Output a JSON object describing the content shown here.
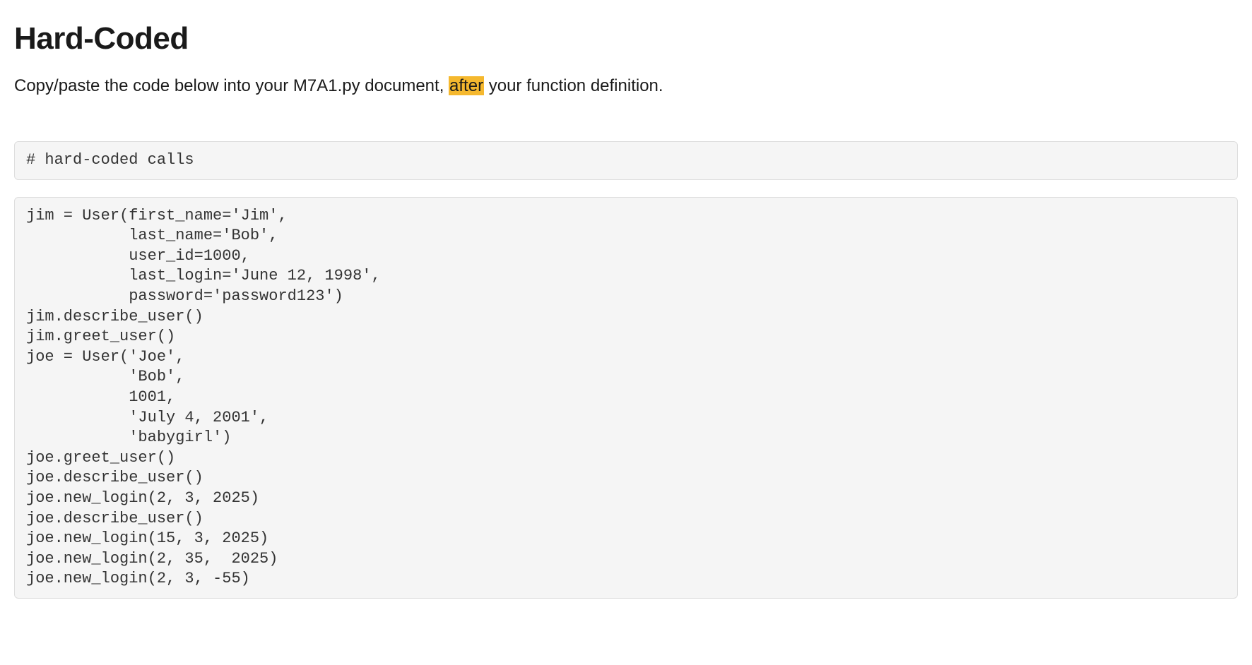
{
  "heading": "Hard-Coded",
  "instruction_pre": "Copy/paste the code below into your M7A1.py document, ",
  "instruction_highlight": "after",
  "instruction_post": " your function definition.",
  "code_block_1": "# hard-coded calls",
  "code_block_2": "jim = User(first_name='Jim',\n           last_name='Bob',\n           user_id=1000,\n           last_login='June 12, 1998',\n           password='password123')\njim.describe_user()\njim.greet_user()\njoe = User('Joe',\n           'Bob',\n           1001,\n           'July 4, 2001',\n           'babygirl')\njoe.greet_user()\njoe.describe_user()\njoe.new_login(2, 3, 2025)\njoe.describe_user()\njoe.new_login(15, 3, 2025)\njoe.new_login(2, 35,  2025)\njoe.new_login(2, 3, -55)"
}
